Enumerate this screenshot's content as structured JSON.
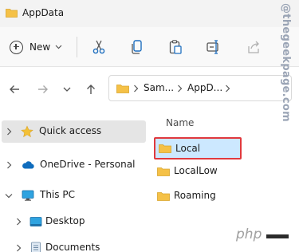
{
  "window": {
    "title": "AppData"
  },
  "toolbar": {
    "new_label": "New"
  },
  "address": {
    "segments": [
      "Sam...",
      "AppD..."
    ]
  },
  "nav": {
    "items": [
      {
        "label": "Quick access",
        "icon": "star-icon"
      },
      {
        "label": "OneDrive - Personal",
        "icon": "cloud-icon"
      },
      {
        "label": "This PC",
        "icon": "computer-icon"
      },
      {
        "label": "Desktop",
        "icon": "desktop-icon"
      },
      {
        "label": "Documents",
        "icon": "documents-icon"
      }
    ]
  },
  "content": {
    "column_header": "Name",
    "files": [
      {
        "name": "Local"
      },
      {
        "name": "LocalLow"
      },
      {
        "name": "Roaming"
      }
    ]
  },
  "watermark": {
    "text": "@thegeekpage.com"
  },
  "badge": {
    "text": "php"
  },
  "colors": {
    "folder": "#f5c147",
    "highlight": "#e0393e",
    "selection": "#cce8ff",
    "accent": "#0067c0"
  }
}
